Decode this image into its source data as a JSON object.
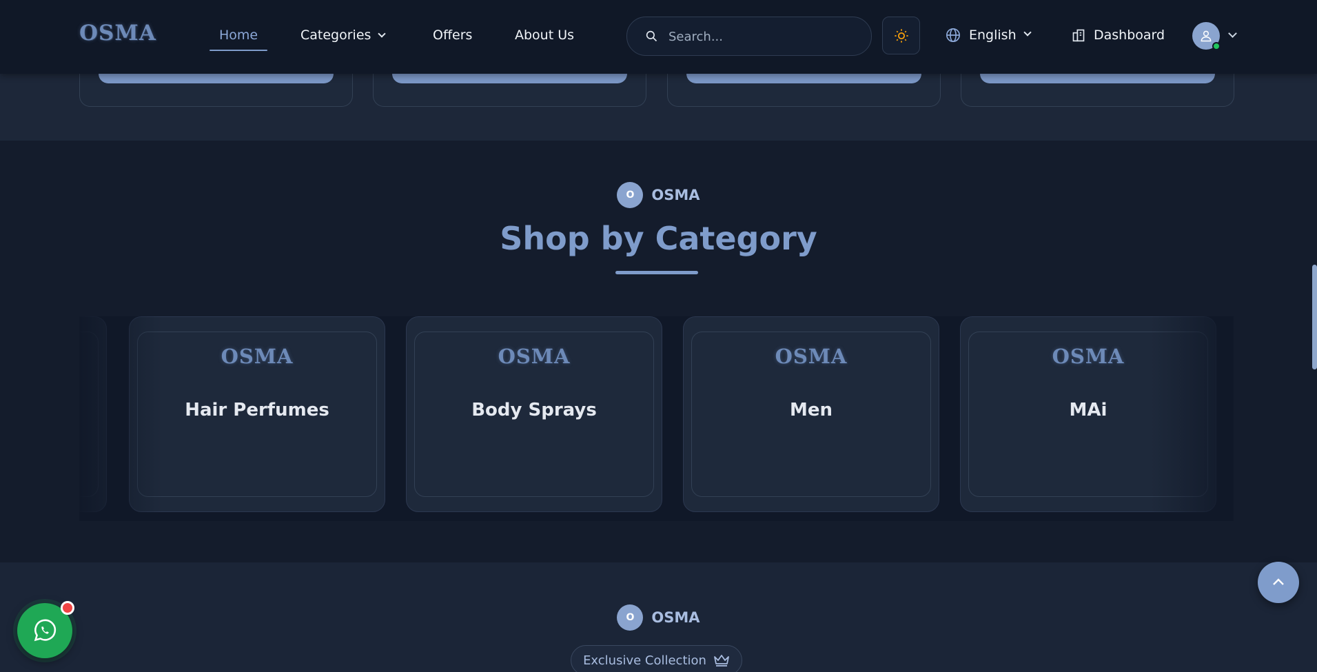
{
  "header": {
    "logo": "OSMA",
    "nav": {
      "home": "Home",
      "categories": "Categories",
      "offers": "Offers",
      "about": "About Us"
    },
    "search": {
      "placeholder": "Search..."
    },
    "theme_icon": "sun-icon",
    "language": "English",
    "dashboard": "Dashboard"
  },
  "category_section": {
    "badge_letter": "O",
    "badge_text": "OSMA",
    "title": "Shop by Category",
    "cards": [
      {
        "logo": "OSMA",
        "name": "Hair Perfumes"
      },
      {
        "logo": "OSMA",
        "name": "Body Sprays"
      },
      {
        "logo": "OSMA",
        "name": "Men"
      },
      {
        "logo": "OSMA",
        "name": "MAi"
      }
    ]
  },
  "bottom_section": {
    "badge_letter": "O",
    "badge_text": "OSMA",
    "pill": "Exclusive Collection",
    "pill_icon": "crown-icon"
  },
  "floating": {
    "whatsapp_icon": "whatsapp-icon",
    "scroll_top_icon": "chevron-up-icon"
  },
  "colors": {
    "accent": "#7f9ccb",
    "header_bg": "#101827",
    "whatsapp": "#1fa855"
  }
}
